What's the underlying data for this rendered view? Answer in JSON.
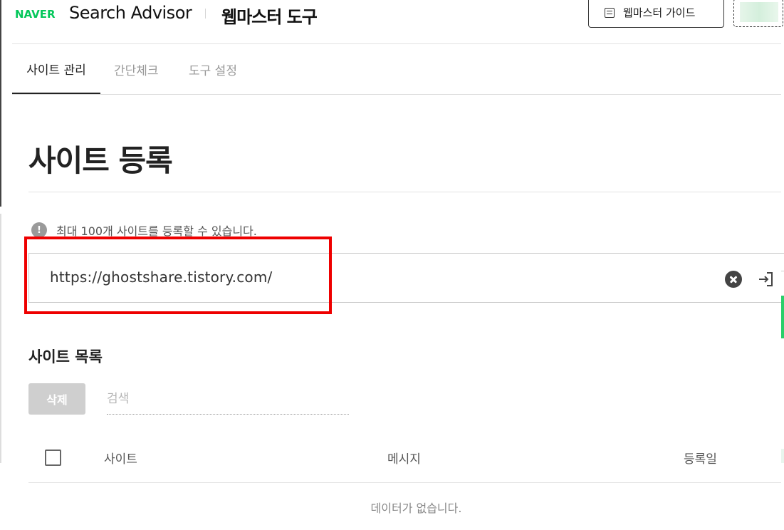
{
  "header": {
    "logo": "NAVER",
    "brand": "Search Advisor",
    "tool": "웹마스터 도구",
    "guide_button": "웹마스터 가이드"
  },
  "tabs": [
    {
      "label": "사이트 관리",
      "active": true
    },
    {
      "label": "간단체크",
      "active": false
    },
    {
      "label": "도구 설정",
      "active": false
    }
  ],
  "page": {
    "title": "사이트 등록",
    "info_icon": "!",
    "info_text": "최대 100개 사이트를 등록할 수 있습니다.",
    "url_value": "https://ghostshare.tistory.com/"
  },
  "list": {
    "title": "사이트 목록",
    "delete_button": "삭제",
    "search_placeholder": "검색",
    "columns": [
      "사이트",
      "메시지",
      "등록일"
    ],
    "empty_text": "데이터가 없습니다."
  },
  "colors": {
    "brand_green": "#03c75a",
    "highlight_red": "#ee0000",
    "disabled_button": "#cfcfcf"
  },
  "icons": [
    "guide-list-icon",
    "info-icon",
    "clear-icon",
    "submit-icon"
  ]
}
